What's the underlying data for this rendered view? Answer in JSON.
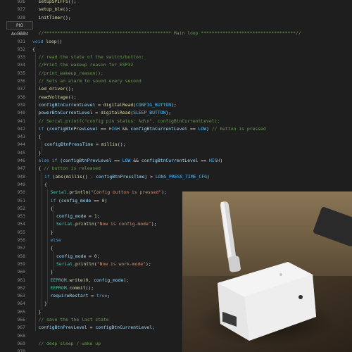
{
  "tooltip": {
    "label": "PIO Account"
  },
  "editor": {
    "lines": [
      {
        "n": "926",
        "indent": 1,
        "segs": [
          [
            "fn",
            "setupSPIFFS"
          ],
          [
            "op",
            "();"
          ]
        ]
      },
      {
        "n": "927",
        "indent": 1,
        "segs": [
          [
            "fn",
            "setup_ble"
          ],
          [
            "op",
            "();"
          ]
        ]
      },
      {
        "n": "928",
        "indent": 1,
        "segs": [
          [
            "fn",
            "initTimer"
          ],
          [
            "op",
            "();"
          ]
        ]
      },
      {
        "n": "929",
        "indent": 0,
        "segs": []
      },
      {
        "n": "930",
        "indent": 1,
        "segs": [
          [
            "cmt",
            "//*********************************************** Main loop ***********************************//"
          ]
        ]
      },
      {
        "n": "931",
        "indent": 0,
        "segs": [
          [
            "kw",
            "void "
          ],
          [
            "fn",
            "loop"
          ],
          [
            "op",
            "()"
          ]
        ]
      },
      {
        "n": "932",
        "indent": 0,
        "segs": [
          [
            "op",
            "{"
          ]
        ]
      },
      {
        "n": "933",
        "indent": 1,
        "segs": [
          [
            "cmt",
            "// read the state of the switch/button:"
          ]
        ]
      },
      {
        "n": "934",
        "indent": 1,
        "segs": [
          [
            "cmt",
            "//Print the wakeup reason for ESP32"
          ]
        ]
      },
      {
        "n": "935",
        "indent": 1,
        "segs": [
          [
            "cmt",
            "//print_wakeup_reason();"
          ]
        ]
      },
      {
        "n": "936",
        "indent": 1,
        "segs": [
          [
            "cmt",
            "// Sets an alarm to sound every second"
          ]
        ]
      },
      {
        "n": "937",
        "indent": 1,
        "segs": [
          [
            "fn",
            "led_driver"
          ],
          [
            "op",
            "();"
          ]
        ]
      },
      {
        "n": "938",
        "indent": 1,
        "segs": [
          [
            "fn",
            "readVoltage"
          ],
          [
            "op",
            "();"
          ]
        ]
      },
      {
        "n": "939",
        "indent": 1,
        "segs": [
          [
            "id",
            "configBtnCurrentLevel"
          ],
          [
            "op",
            " = "
          ],
          [
            "fn",
            "digitalRead"
          ],
          [
            "op",
            "("
          ],
          [
            "cst",
            "CONFIG_BUTTON"
          ],
          [
            "op",
            ");"
          ]
        ]
      },
      {
        "n": "940",
        "indent": 1,
        "segs": [
          [
            "id",
            "powerBtnCurrentLevel"
          ],
          [
            "op",
            " = "
          ],
          [
            "fn",
            "digitalRead"
          ],
          [
            "op",
            "("
          ],
          [
            "cst",
            "SLEEP_BUTTON"
          ],
          [
            "op",
            ");"
          ]
        ]
      },
      {
        "n": "941",
        "indent": 1,
        "segs": [
          [
            "cmt",
            "// Serial.printf(\"config pin status: %d\\n\", configBtnCurrentLevel);"
          ]
        ]
      },
      {
        "n": "942",
        "indent": 1,
        "segs": [
          [
            "kw",
            "if "
          ],
          [
            "op",
            "("
          ],
          [
            "id",
            "configBtnPrevLevel"
          ],
          [
            "op",
            " == "
          ],
          [
            "cst",
            "HIGH"
          ],
          [
            "op",
            " && "
          ],
          [
            "id",
            "configBtnCurrentLevel"
          ],
          [
            "op",
            " == "
          ],
          [
            "cst",
            "LOW"
          ],
          [
            "op",
            ") "
          ],
          [
            "cmt",
            "// button is pressed"
          ]
        ]
      },
      {
        "n": "943",
        "indent": 1,
        "segs": [
          [
            "op",
            "{"
          ]
        ]
      },
      {
        "n": "944",
        "indent": 2,
        "segs": [
          [
            "id",
            "configBtnPressTime"
          ],
          [
            "op",
            " = "
          ],
          [
            "fn",
            "millis"
          ],
          [
            "op",
            "();"
          ]
        ]
      },
      {
        "n": "945",
        "indent": 1,
        "segs": [
          [
            "op",
            "}"
          ]
        ]
      },
      {
        "n": "946",
        "indent": 1,
        "segs": [
          [
            "kw",
            "else if "
          ],
          [
            "op",
            "("
          ],
          [
            "id",
            "configBtnPrevLevel"
          ],
          [
            "op",
            " == "
          ],
          [
            "cst",
            "LOW"
          ],
          [
            "op",
            " && "
          ],
          [
            "id",
            "configBtnCurrentLevel"
          ],
          [
            "op",
            " == "
          ],
          [
            "cst",
            "HIGH"
          ],
          [
            "op",
            ")"
          ]
        ]
      },
      {
        "n": "947",
        "indent": 1,
        "segs": [
          [
            "op",
            "{ "
          ],
          [
            "cmt",
            "// button is released"
          ]
        ]
      },
      {
        "n": "948",
        "indent": 2,
        "segs": [
          [
            "kw",
            "if "
          ],
          [
            "op",
            "("
          ],
          [
            "fn",
            "abs"
          ],
          [
            "op",
            "("
          ],
          [
            "fn",
            "millis"
          ],
          [
            "op",
            "() - "
          ],
          [
            "id",
            "configBtnPressTime"
          ],
          [
            "op",
            ") > "
          ],
          [
            "cst",
            "LONG_PRESS_TIME_CFG"
          ],
          [
            "op",
            ")"
          ]
        ]
      },
      {
        "n": "949",
        "indent": 2,
        "segs": [
          [
            "op",
            "{"
          ]
        ]
      },
      {
        "n": "950",
        "indent": 3,
        "segs": [
          [
            "cls",
            "Serial"
          ],
          [
            "op",
            "."
          ],
          [
            "fn",
            "println"
          ],
          [
            "op",
            "("
          ],
          [
            "str",
            "\"Config button is pressed\""
          ],
          [
            "op",
            ");"
          ]
        ]
      },
      {
        "n": "951",
        "indent": 3,
        "segs": [
          [
            "kw",
            "if "
          ],
          [
            "op",
            "("
          ],
          [
            "id",
            "config_mode"
          ],
          [
            "op",
            " == "
          ],
          [
            "num",
            "0"
          ],
          [
            "op",
            ")"
          ]
        ]
      },
      {
        "n": "952",
        "indent": 3,
        "segs": [
          [
            "op",
            "{"
          ]
        ]
      },
      {
        "n": "953",
        "indent": 4,
        "segs": [
          [
            "id",
            "config_mode"
          ],
          [
            "op",
            " = "
          ],
          [
            "num",
            "1"
          ],
          [
            "op",
            ";"
          ]
        ]
      },
      {
        "n": "954",
        "indent": 4,
        "segs": [
          [
            "cls",
            "Serial"
          ],
          [
            "op",
            "."
          ],
          [
            "fn",
            "println"
          ],
          [
            "op",
            "("
          ],
          [
            "str",
            "\"Now is config-mode\""
          ],
          [
            "op",
            ");"
          ]
        ]
      },
      {
        "n": "955",
        "indent": 3,
        "segs": [
          [
            "op",
            "}"
          ]
        ]
      },
      {
        "n": "956",
        "indent": 3,
        "segs": [
          [
            "kw",
            "else"
          ]
        ]
      },
      {
        "n": "957",
        "indent": 3,
        "segs": [
          [
            "op",
            "{"
          ]
        ]
      },
      {
        "n": "958",
        "indent": 4,
        "segs": [
          [
            "id",
            "config_mode"
          ],
          [
            "op",
            " = "
          ],
          [
            "num",
            "0"
          ],
          [
            "op",
            ";"
          ]
        ]
      },
      {
        "n": "959",
        "indent": 4,
        "segs": [
          [
            "cls",
            "Serial"
          ],
          [
            "op",
            "."
          ],
          [
            "fn",
            "println"
          ],
          [
            "op",
            "("
          ],
          [
            "str",
            "\"Now is work-mode\""
          ],
          [
            "op",
            ");"
          ]
        ]
      },
      {
        "n": "960",
        "indent": 3,
        "segs": [
          [
            "op",
            "}"
          ]
        ]
      },
      {
        "n": "961",
        "indent": 3,
        "segs": [
          [
            "cls",
            "EEPROM"
          ],
          [
            "op",
            "."
          ],
          [
            "fn",
            "write"
          ],
          [
            "op",
            "("
          ],
          [
            "num",
            "0"
          ],
          [
            "op",
            ", "
          ],
          [
            "id",
            "config_mode"
          ],
          [
            "op",
            ");"
          ]
        ]
      },
      {
        "n": "962",
        "indent": 3,
        "segs": [
          [
            "cls",
            "EEPROM"
          ],
          [
            "op",
            "."
          ],
          [
            "fn",
            "commit"
          ],
          [
            "op",
            "();"
          ]
        ]
      },
      {
        "n": "963",
        "indent": 3,
        "segs": [
          [
            "id",
            "requireRestart"
          ],
          [
            "op",
            " = "
          ],
          [
            "kw",
            "true"
          ],
          [
            "op",
            ";"
          ]
        ]
      },
      {
        "n": "964",
        "indent": 2,
        "segs": [
          [
            "op",
            "}"
          ]
        ]
      },
      {
        "n": "965",
        "indent": 1,
        "segs": [
          [
            "op",
            "}"
          ]
        ]
      },
      {
        "n": "966",
        "indent": 1,
        "segs": [
          [
            "cmt",
            "// save the the last state"
          ]
        ]
      },
      {
        "n": "967",
        "indent": 1,
        "segs": [
          [
            "id",
            "configBtnPrevLevel"
          ],
          [
            "op",
            " = "
          ],
          [
            "id",
            "configBtnCurrentLevel"
          ],
          [
            "op",
            ";"
          ]
        ]
      },
      {
        "n": "968",
        "indent": 0,
        "segs": []
      },
      {
        "n": "969",
        "indent": 1,
        "segs": [
          [
            "cmt",
            "// deep sleep / wake up"
          ]
        ]
      },
      {
        "n": "970",
        "indent": 0,
        "segs": []
      }
    ]
  },
  "photo": {
    "device_label": "router-photo"
  }
}
